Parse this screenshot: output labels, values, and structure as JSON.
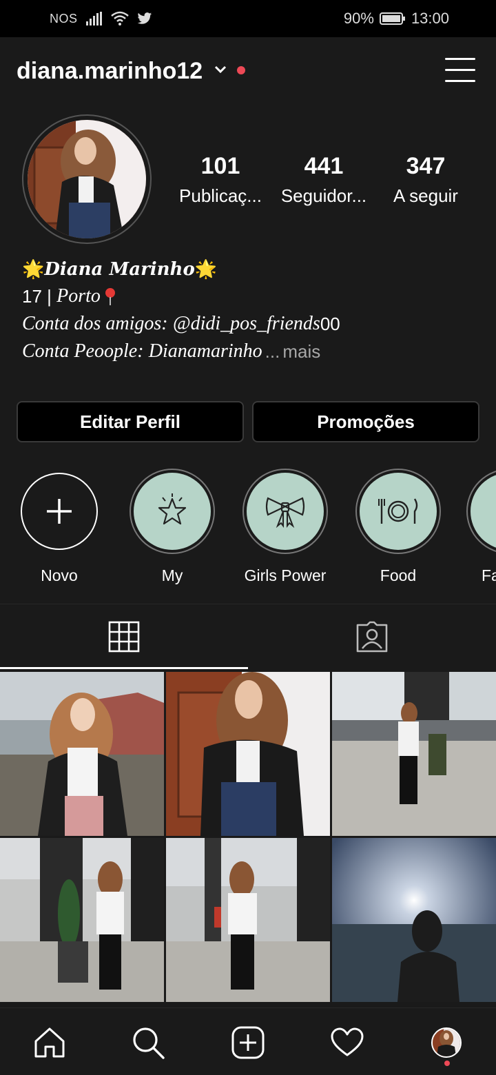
{
  "status_bar": {
    "carrier": "NOS",
    "battery": "90%",
    "time": "13:00",
    "icons": [
      "signal-icon",
      "wifi-icon",
      "twitter-icon",
      "battery-icon"
    ]
  },
  "header": {
    "username": "diana.marinho12",
    "notification_color": "#ed4956"
  },
  "profile": {
    "stats": [
      {
        "value": "101",
        "label": "Publicaç..."
      },
      {
        "value": "441",
        "label": "Seguidor..."
      },
      {
        "value": "347",
        "label": "A seguir"
      }
    ],
    "bio": {
      "name": "Diana Marinho",
      "age": "17 |",
      "city": "Porto",
      "line3_prefix": "Conta dos amigos:",
      "line3_handle": "@didi_pos_friends",
      "line3_suffix": "00",
      "line4_prefix": "Conta Peoople:",
      "line4_value": "Dianamarinho",
      "line4_ellipsis": "...",
      "more": "mais"
    }
  },
  "buttons": {
    "edit_profile": "Editar Perfil",
    "promotions": "Promoções"
  },
  "highlights": [
    {
      "label": "Novo",
      "icon": "plus-icon"
    },
    {
      "label": "My",
      "icon": "star-icon"
    },
    {
      "label": "Girls Power",
      "icon": "bow-icon"
    },
    {
      "label": "Food",
      "icon": "plate-cutlery-icon"
    },
    {
      "label": "Fa",
      "icon": "phone-icon"
    }
  ],
  "tabs": [
    {
      "name": "grid",
      "icon": "grid-icon",
      "active": true
    },
    {
      "name": "tagged",
      "icon": "tagged-user-icon",
      "active": false
    }
  ],
  "colors": {
    "background": "#1a1a1a",
    "highlight_fill": "#b6d4c8",
    "accent_red": "#ed4956"
  },
  "nav": [
    "home-icon",
    "search-icon",
    "new-post-icon",
    "activity-heart-icon",
    "profile-avatar"
  ]
}
